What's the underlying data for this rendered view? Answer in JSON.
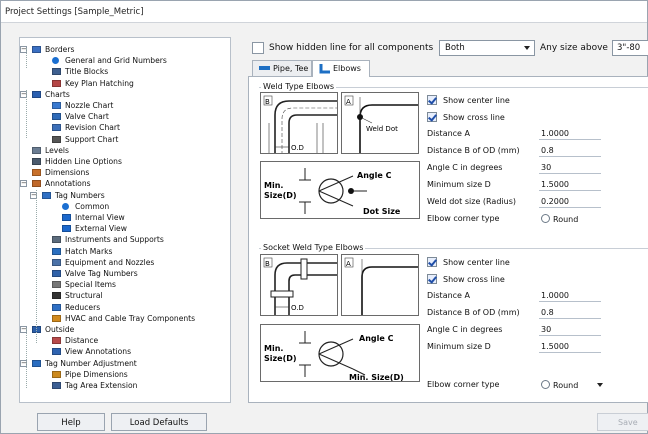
{
  "window": {
    "title": "Project Settings [Sample_Metric]"
  },
  "tree": {
    "items": [
      {
        "label": "Borders",
        "icon": "border-icon",
        "expander": "−"
      },
      {
        "label": "General and Grid Numbers",
        "icon": "blue-dot-icon"
      },
      {
        "label": "Title Blocks",
        "icon": "title-block-icon"
      },
      {
        "label": "Key Plan Hatching",
        "icon": "hatch-icon"
      },
      {
        "label": "Charts",
        "icon": "charts-icon",
        "expander": "−"
      },
      {
        "label": "Nozzle Chart",
        "icon": "nozzle-chart-icon"
      },
      {
        "label": "Valve Chart",
        "icon": "valve-chart-icon"
      },
      {
        "label": "Revision Chart",
        "icon": "revision-chart-icon"
      },
      {
        "label": "Support Chart",
        "icon": "support-chart-icon"
      },
      {
        "label": "Levels",
        "icon": "levels-icon"
      },
      {
        "label": "Hidden Line Options",
        "icon": "hidden-line-icon"
      },
      {
        "label": "Dimensions",
        "icon": "dimension-icon"
      },
      {
        "label": "Annotations",
        "icon": "annotations-icon",
        "expander": "−"
      },
      {
        "label": "Tag Numbers",
        "icon": "tag-icon",
        "expander": "−"
      },
      {
        "label": "Common",
        "icon": "blue-dot-icon"
      },
      {
        "label": "Internal View",
        "icon": "blue-rect-icon"
      },
      {
        "label": "External View",
        "icon": "blue-rect-icon"
      },
      {
        "label": "Instruments and Supports",
        "icon": "instrument-icon"
      },
      {
        "label": "Hatch Marks",
        "icon": "hatch-marks-icon"
      },
      {
        "label": "Equipment and Nozzles",
        "icon": "equipment-icon"
      },
      {
        "label": "Valve Tag Numbers",
        "icon": "valve-tag-icon"
      },
      {
        "label": "Special Items",
        "icon": "special-items-icon"
      },
      {
        "label": "Structural",
        "icon": "structural-icon"
      },
      {
        "label": "Reducers",
        "icon": "reducer-icon"
      },
      {
        "label": "HVAC and Cable Tray Components",
        "icon": "hvac-icon"
      },
      {
        "label": "Outside",
        "icon": "outside-icon",
        "expander": "−"
      },
      {
        "label": "Distance",
        "icon": "distance-icon"
      },
      {
        "label": "View Annotations",
        "icon": "view-annotations-icon"
      },
      {
        "label": "Tag Number Adjustment",
        "icon": "tag-adjust-icon",
        "expander": "−"
      },
      {
        "label": "Pipe Dimensions",
        "icon": "pipe-dim-icon"
      },
      {
        "label": "Tag Area Extension",
        "icon": "tag-area-icon"
      }
    ]
  },
  "top": {
    "show_hidden_label": "Show hidden line for all components",
    "show_hidden_checked": false,
    "both_value": "Both",
    "any_size_label": "Any size above",
    "any_size_value": "3\"-80"
  },
  "tabs": [
    {
      "label": "Pipe, Tee",
      "active": false
    },
    {
      "label": "Elbows",
      "active": true
    }
  ],
  "weld": {
    "title": "Weld Type Elbows",
    "diagram": {
      "b": "B",
      "a": "A",
      "od": "O.D",
      "weld_dot": "Weld Dot",
      "min": "Min.",
      "size_d": "Size(D)",
      "angle_c": "Angle C",
      "dot_size": "Dot Size"
    },
    "show_center_line": "Show center line",
    "show_cross_line": "Show cross line",
    "fields": [
      {
        "label": "Distance A",
        "value": "1.0000"
      },
      {
        "label": "Distance B of OD (mm)",
        "value": "0.8"
      },
      {
        "label": "Angle C in degrees",
        "value": "30"
      },
      {
        "label": "Minimum size D",
        "value": "1.5000"
      },
      {
        "label": "Weld dot size (Radius)",
        "value": "0.2000"
      }
    ],
    "corner_label": "Elbow corner type",
    "corner_value": "Round"
  },
  "socket": {
    "title": "Socket Weld Type Elbows",
    "diagram": {
      "b": "B",
      "a": "A",
      "od": "O.D",
      "min": "Min.",
      "size_d": "Size(D)",
      "angle_c": "Angle C",
      "min_size_d": "Min. Size(D)"
    },
    "show_center_line": "Show center line",
    "show_cross_line": "Show cross line",
    "fields": [
      {
        "label": "Distance A",
        "value": "1.0000"
      },
      {
        "label": "Distance B of OD (mm)",
        "value": "0.8"
      },
      {
        "label": "Angle C in degrees",
        "value": "30"
      },
      {
        "label": "Minimum size D",
        "value": "1.5000"
      }
    ],
    "corner_label": "Elbow corner type",
    "corner_value": "Round"
  },
  "buttons": {
    "help": "Help",
    "load_defaults": "Load Defaults",
    "save": "Save"
  }
}
